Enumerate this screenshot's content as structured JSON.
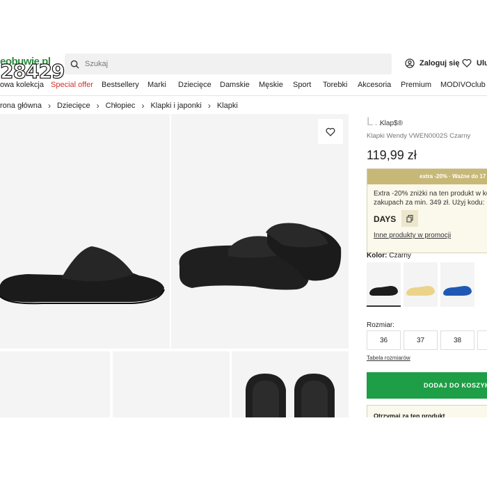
{
  "header": {
    "logo_text": "eobuwie.pl",
    "overlay_code": "28429",
    "search_placeholder": "Szukaj",
    "login_label": "Zaloguj się",
    "fav_label": "Ulub"
  },
  "nav": {
    "items": [
      "owa kolekcja",
      "Special offer",
      "Bestsellery",
      "Marki",
      "Dziecięce",
      "Damskie",
      "Męskie",
      "Sport",
      "Torebki",
      "Akcesoria",
      "Premium",
      "MODIVOclub G"
    ]
  },
  "breadcrumb": [
    "rona główna",
    "Dziecięce",
    "Chłopiec",
    "Klapki i japonki",
    "Klapki"
  ],
  "product": {
    "brand": "L…",
    "brand_tag": "Klap$®",
    "name": "Klapki Wendy VWEN0002S Czarny",
    "price": "119,99 zł",
    "promo_bar": "extra -20% · Ważne do 17",
    "promo_line1": "Extra -20% zniżki na ten produkt w ko",
    "promo_line2": "zakupach za min. 349 zł. Użyj kodu: D",
    "promo_code": "DAYS",
    "promo_link": "Inne produkty w promocji",
    "color_label": "Kolor:",
    "color_value": "Czarny",
    "swatch_colors": [
      "#1c1c1c",
      "#ecd38a",
      "#1f59b4"
    ],
    "size_label": "Rozmiar:",
    "sizes": [
      "36",
      "37",
      "38"
    ],
    "size_table_link": "Tabela rozmiarów",
    "add_to_cart": "DODAJ DO KOSZYK",
    "receive_text": "Otrzymaj za ten produkt"
  },
  "colors": {
    "accent_green": "#1e9e46",
    "special_red": "#d0302c",
    "promo_gold": "#c7b878"
  }
}
